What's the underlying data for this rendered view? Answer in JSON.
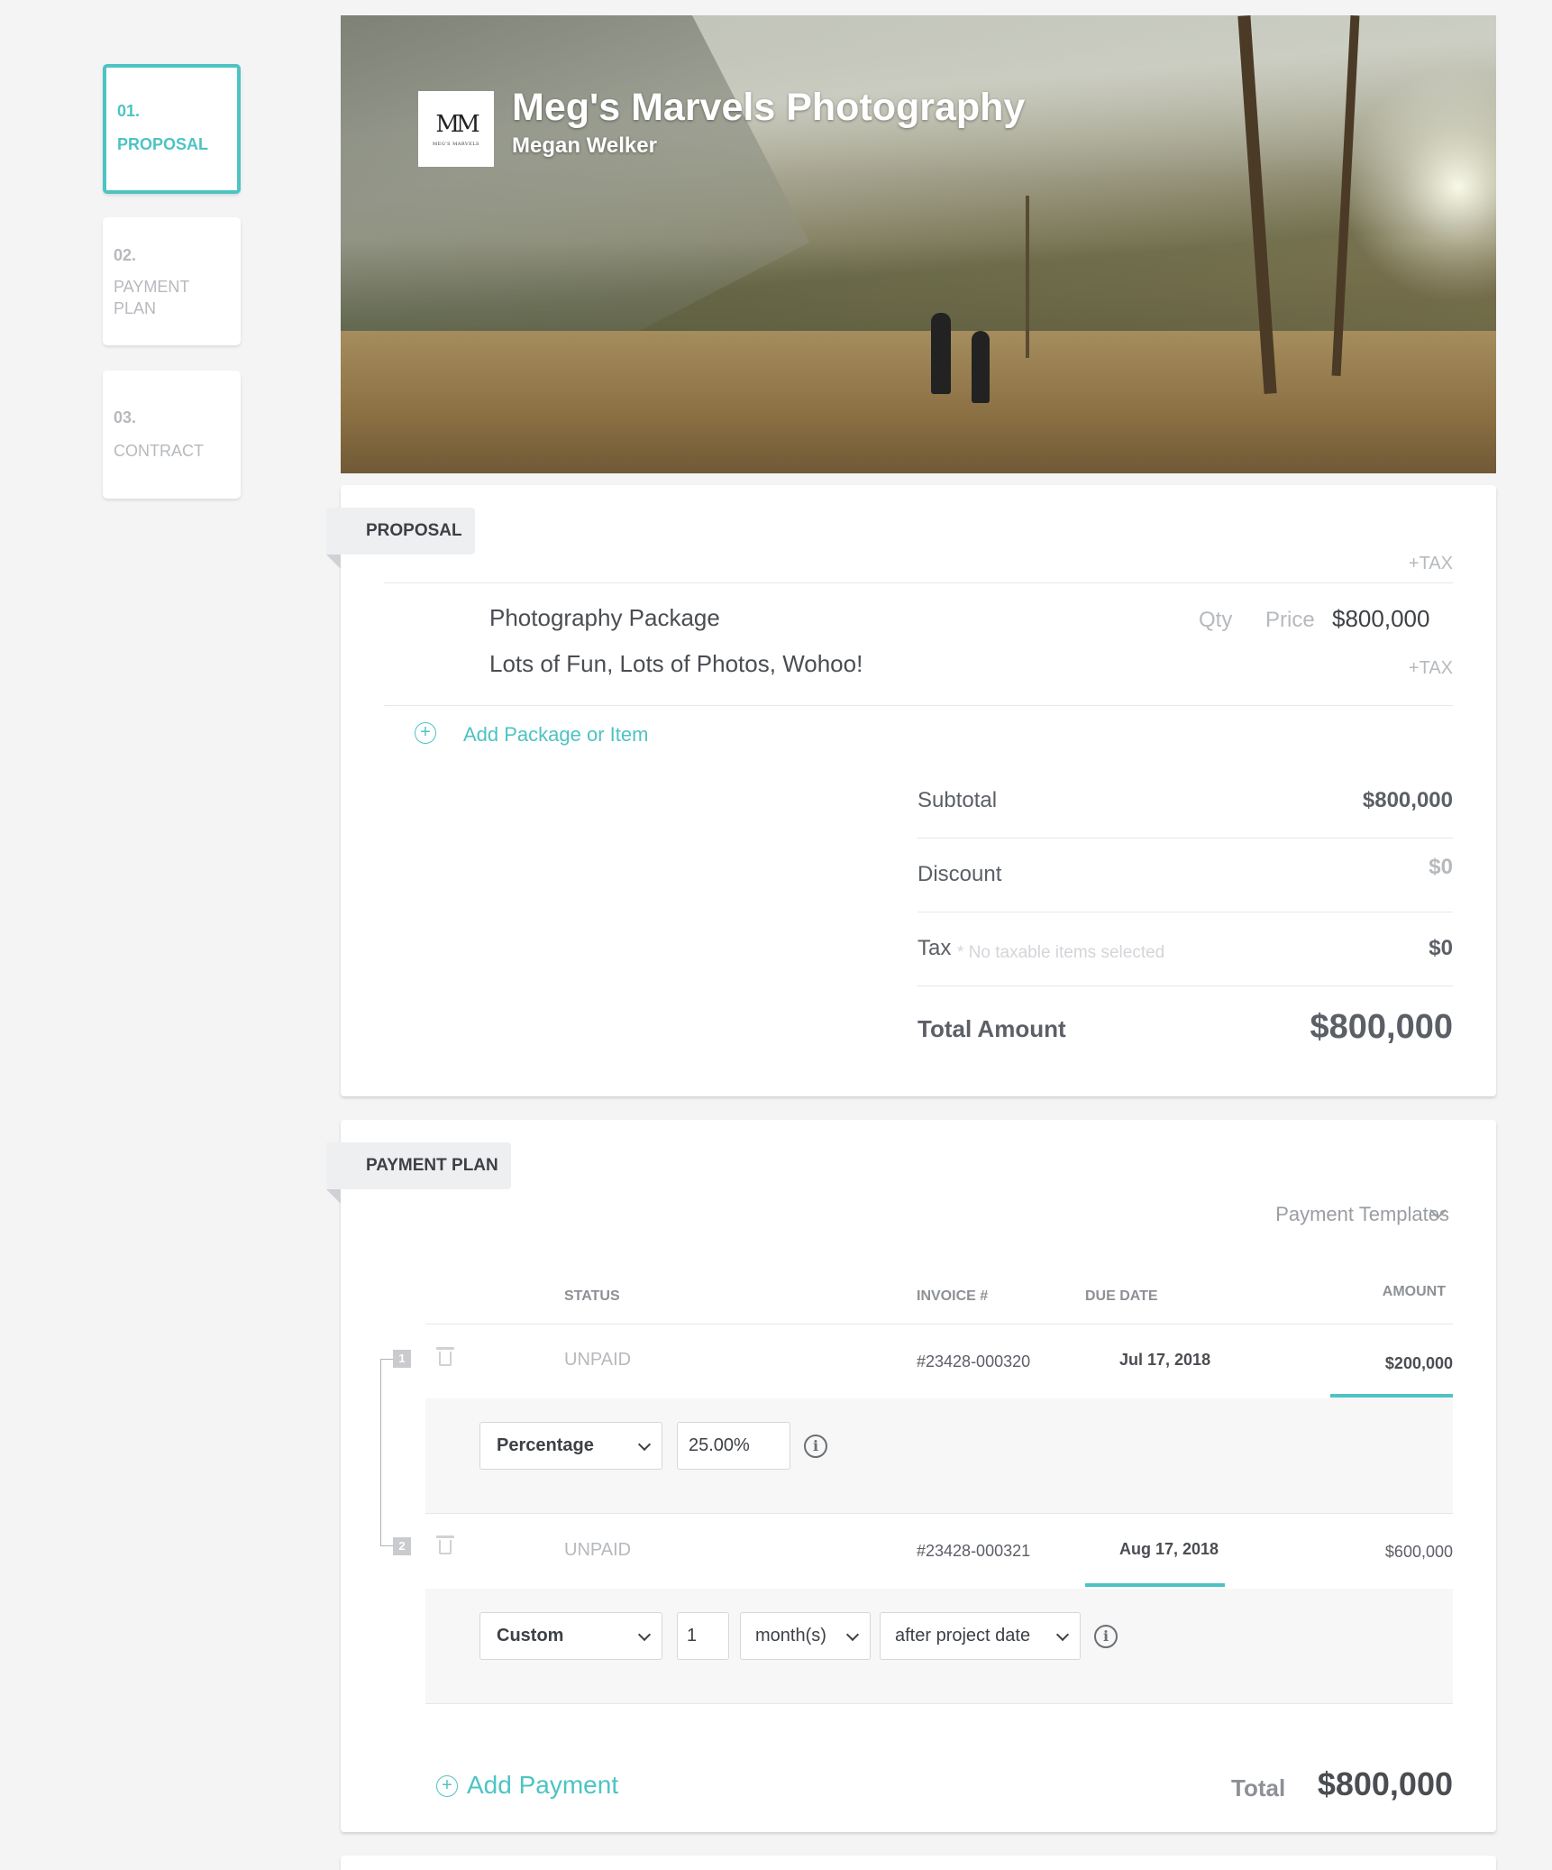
{
  "steps": [
    {
      "num": "01.",
      "label": "PROPOSAL"
    },
    {
      "num": "02.",
      "label1": "PAYMENT",
      "label2": "PLAN"
    },
    {
      "num": "03.",
      "label": "CONTRACT"
    }
  ],
  "hero": {
    "logo_mono": "MM",
    "logo_sub": "MEG'S MARVELS",
    "business_name": "Meg's Marvels Photography",
    "owner_name": "Megan Welker"
  },
  "proposal": {
    "section_title": "PROPOSAL",
    "tax_header": "+TAX",
    "item": {
      "name": "Photography Package",
      "description": "Lots of Fun, Lots of Photos, Wohoo!",
      "qty_label": "Qty",
      "price_label": "Price",
      "price_value": "$800,000",
      "tax_label": "+TAX"
    },
    "add_item_label": "Add Package or Item",
    "summary": {
      "subtotal_label": "Subtotal",
      "subtotal_value": "$800,000",
      "discount_label": "Discount",
      "discount_value": "$0",
      "tax_label": "Tax",
      "tax_note": "* No taxable items selected",
      "tax_value": "$0",
      "total_label": "Total Amount",
      "total_value": "$800,000"
    }
  },
  "payment_plan": {
    "section_title": "PAYMENT PLAN",
    "templates_label": "Payment Templates",
    "columns": {
      "status": "STATUS",
      "invoice": "INVOICE #",
      "due_date": "DUE DATE",
      "amount": "AMOUNT"
    },
    "payments": [
      {
        "index": "1",
        "status": "UNPAID",
        "invoice": "#23428-000320",
        "due_date": "Jul 17, 2018",
        "amount": "$200,000",
        "type": "Percentage",
        "percent": "25.00%"
      },
      {
        "index": "2",
        "status": "UNPAID",
        "invoice": "#23428-000321",
        "due_date": "Aug 17, 2018",
        "amount": "$600,000",
        "type": "Custom",
        "count": "1",
        "unit": "month(s)",
        "relative": "after project date"
      }
    ],
    "add_payment_label": "Add Payment",
    "total_label": "Total",
    "total_value": "$800,000"
  },
  "colors": {
    "accent": "#4ec3c3",
    "text": "#5b5f66",
    "muted": "#b6b9bd",
    "background": "#f4f4f5"
  }
}
